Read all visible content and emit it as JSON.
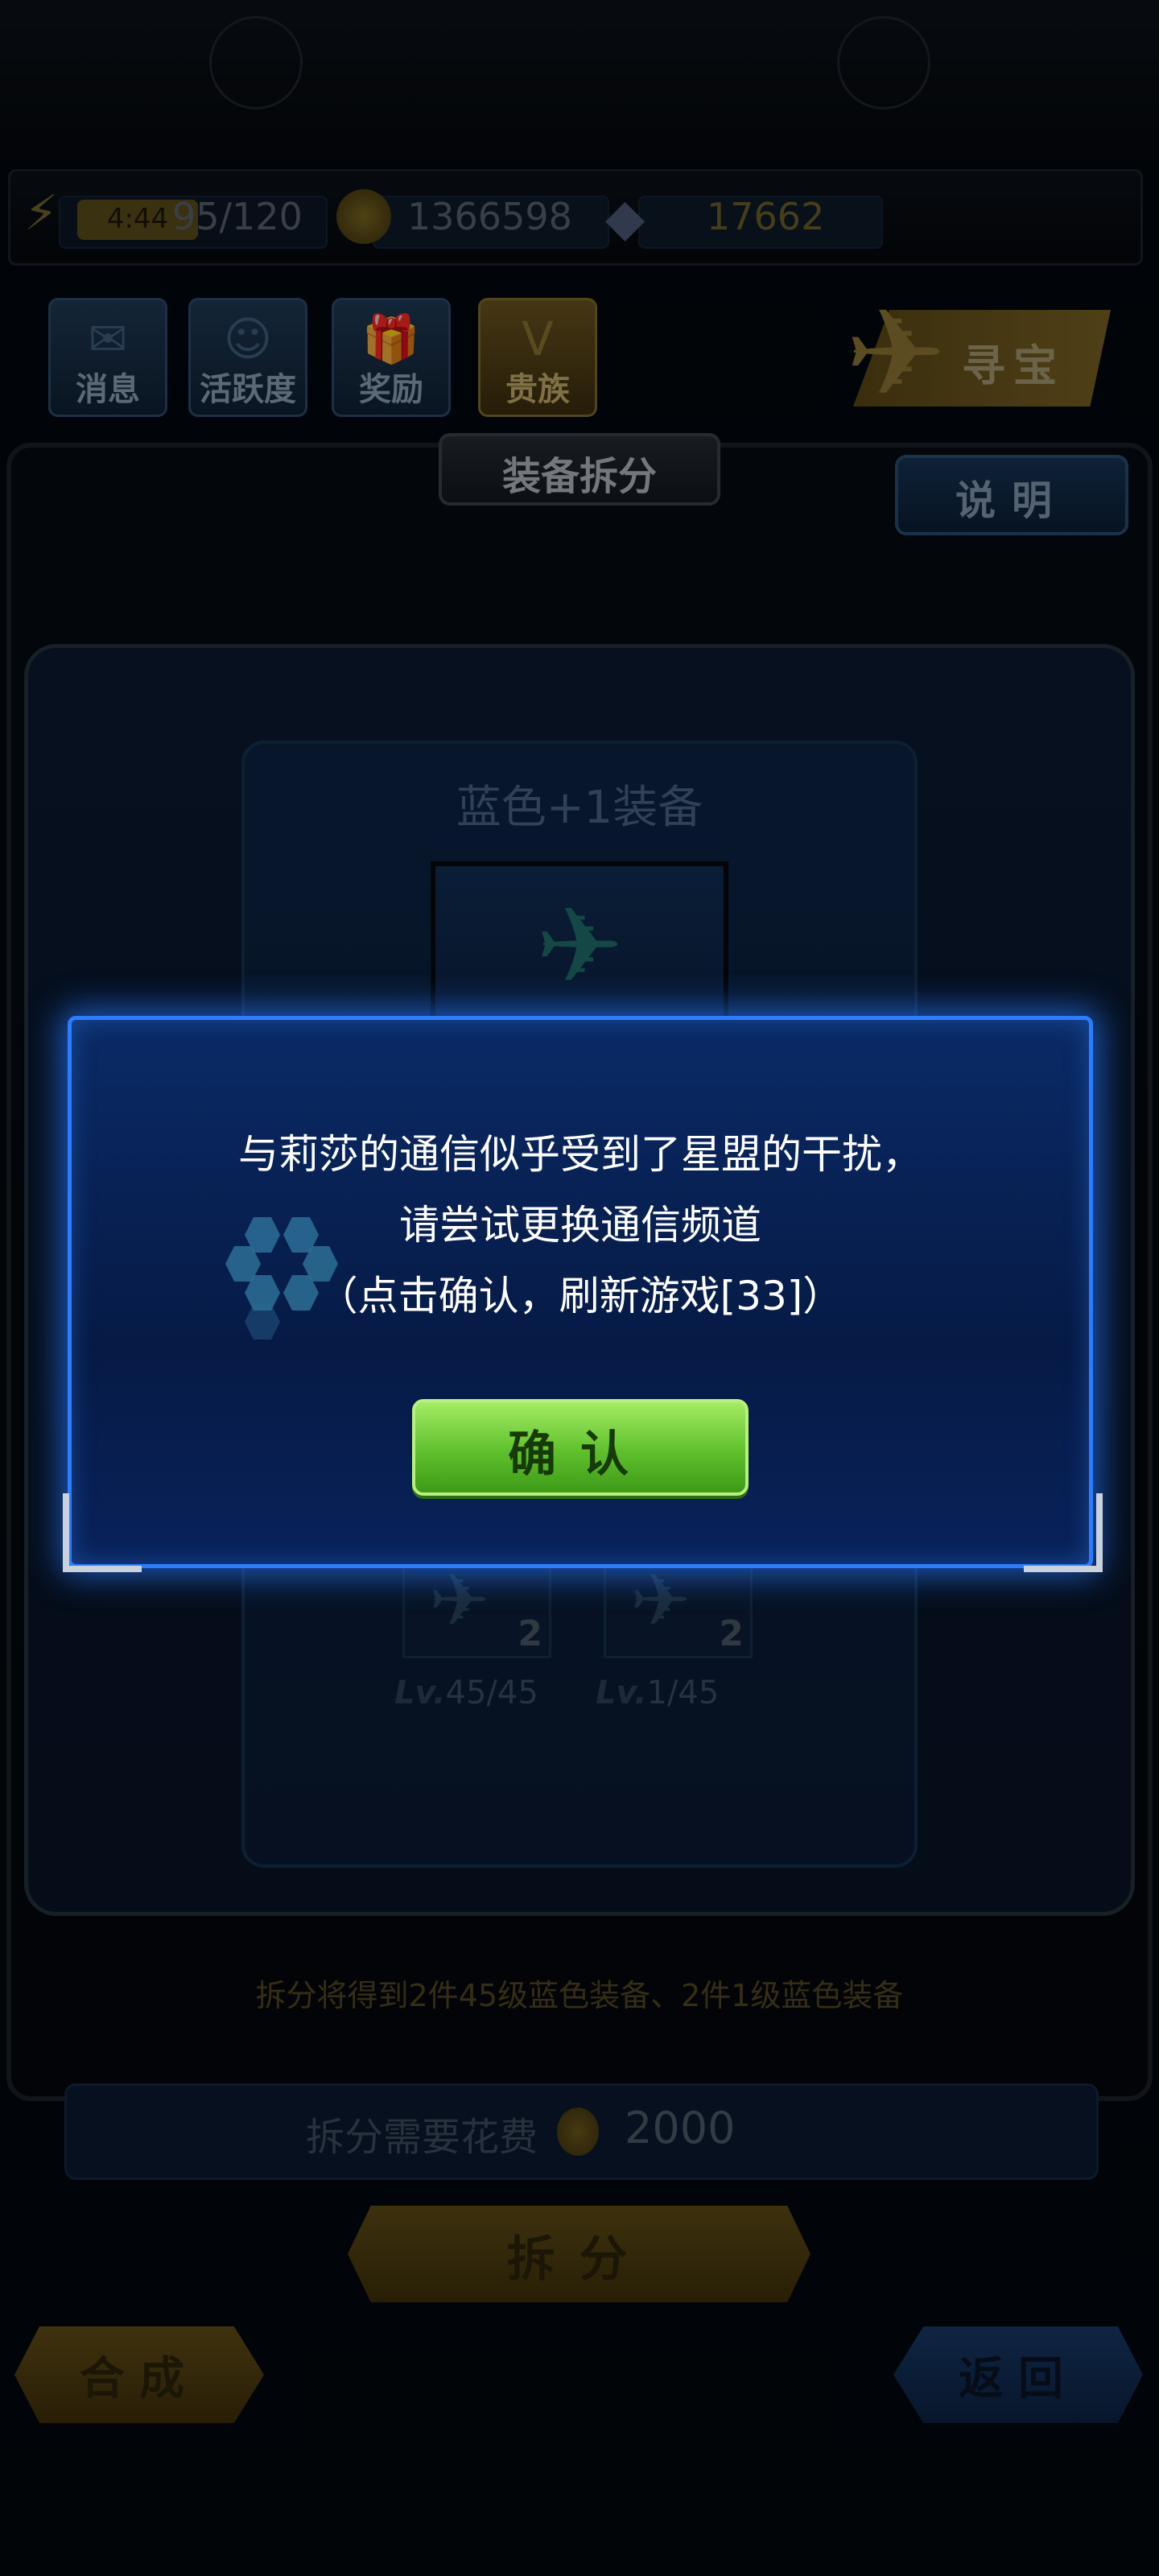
{
  "resources": {
    "timer": "4:44",
    "energy": "95/120",
    "gold": "1366598",
    "diamonds": "17662"
  },
  "menu": {
    "messages": "消息",
    "activity": "活跃度",
    "rewards": "奖励",
    "noble": "贵族",
    "treasure": "寻宝"
  },
  "panel": {
    "title": "装备拆分",
    "help": "说明"
  },
  "equipment": {
    "name": "蓝色+1装备",
    "results": [
      {
        "count": "2",
        "lv_prefix": "Lv.",
        "lv_value": "45/45"
      },
      {
        "count": "2",
        "lv_prefix": "Lv.",
        "lv_value": "1/45"
      }
    ]
  },
  "split": {
    "note": "拆分将得到2件45级蓝色装备、2件1级蓝色装备",
    "cost_label": "拆分需要花费",
    "cost_value": "2000",
    "button": "拆分"
  },
  "bottom": {
    "merge": "合成",
    "back": "返回"
  },
  "dialog": {
    "line1": "与莉莎的通信似乎受到了星盟的干扰，",
    "line2": "请尝试更换通信频道",
    "line3": "（点击确认，刷新游戏[33]）",
    "confirm": "确认"
  },
  "colors": {
    "dialog_border": "#2c7cff",
    "confirm_green": "#5fc02b",
    "gold_accent": "#7a6224"
  },
  "icons": [
    "energy-icon",
    "gold-coin-icon",
    "diamond-icon",
    "envelope-icon",
    "smiley-icon",
    "gift-icon",
    "v-crest-icon",
    "fighter-jet-icon",
    "hexagon-loader-icon"
  ]
}
